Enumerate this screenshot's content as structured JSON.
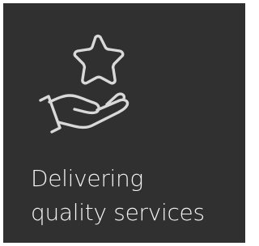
{
  "card": {
    "background": "#303030",
    "text_color": "#f4f4f4",
    "icon_name": "hand-with-star-icon",
    "caption_line1": "Delivering",
    "caption_line2": "quality services"
  }
}
